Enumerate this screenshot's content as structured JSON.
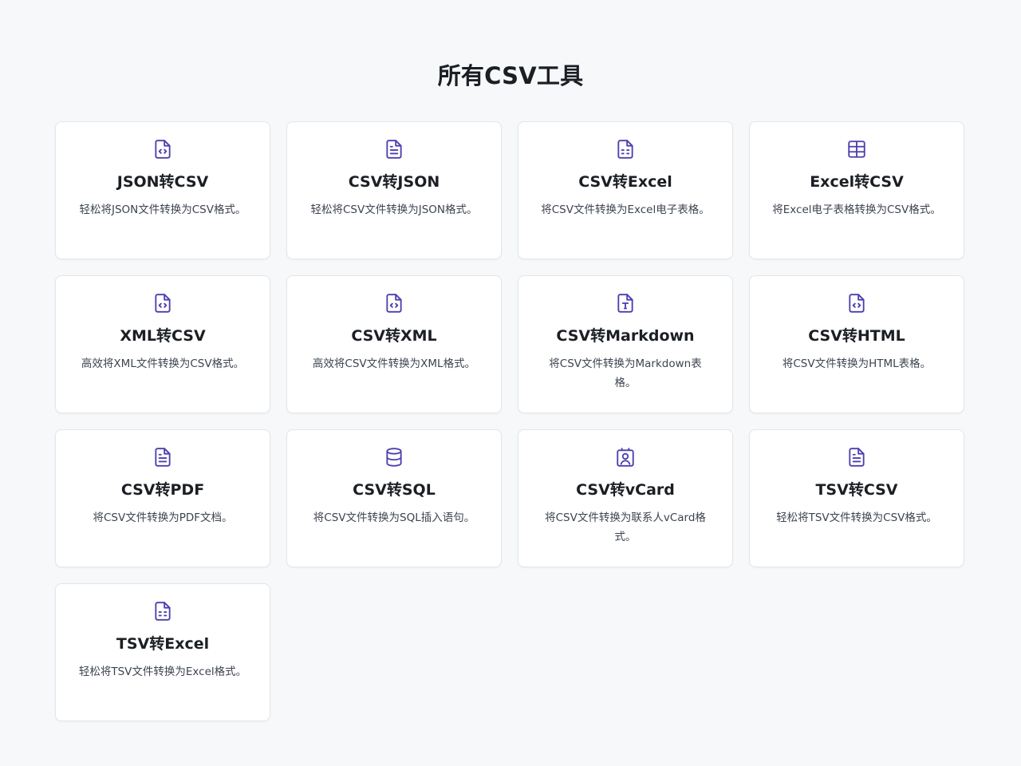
{
  "page": {
    "title": "所有CSV工具"
  },
  "colors": {
    "background": "#f6f8fa",
    "card": "#ffffff",
    "icon": "#4b3fae",
    "title": "#1b1f24",
    "description": "#3d4450"
  },
  "tools": [
    {
      "icon": "file-code-icon",
      "title": "JSON转CSV",
      "description": "轻松将JSON文件转换为CSV格式。"
    },
    {
      "icon": "file-text-icon",
      "title": "CSV转JSON",
      "description": "轻松将CSV文件转换为JSON格式。"
    },
    {
      "icon": "file-spreadsheet-icon",
      "title": "CSV转Excel",
      "description": "将CSV文件转换为Excel电子表格。"
    },
    {
      "icon": "table-icon",
      "title": "Excel转CSV",
      "description": "将Excel电子表格转换为CSV格式。"
    },
    {
      "icon": "file-code-icon",
      "title": "XML转CSV",
      "description": "高效将XML文件转换为CSV格式。"
    },
    {
      "icon": "file-code-icon",
      "title": "CSV转XML",
      "description": "高效将CSV文件转换为XML格式。"
    },
    {
      "icon": "file-type-icon",
      "title": "CSV转Markdown",
      "description": "将CSV文件转换为Markdown表格。"
    },
    {
      "icon": "file-code-icon",
      "title": "CSV转HTML",
      "description": "将CSV文件转换为HTML表格。"
    },
    {
      "icon": "file-text-icon",
      "title": "CSV转PDF",
      "description": "将CSV文件转换为PDF文档。"
    },
    {
      "icon": "database-icon",
      "title": "CSV转SQL",
      "description": "将CSV文件转换为SQL插入语句。"
    },
    {
      "icon": "contact-icon",
      "title": "CSV转vCard",
      "description": "将CSV文件转换为联系人vCard格式。"
    },
    {
      "icon": "file-text-icon",
      "title": "TSV转CSV",
      "description": "轻松将TSV文件转换为CSV格式。"
    },
    {
      "icon": "file-spreadsheet-icon",
      "title": "TSV转Excel",
      "description": "轻松将TSV文件转换为Excel格式。"
    }
  ]
}
